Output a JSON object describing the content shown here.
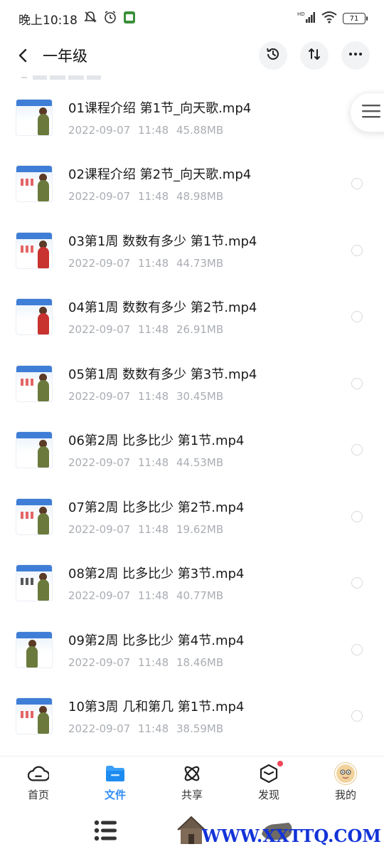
{
  "status_bar": {
    "time": "晚上10:18",
    "battery": "71"
  },
  "header": {
    "title": "一年级",
    "actions": [
      "history-icon",
      "sort-icon",
      "more-icon"
    ]
  },
  "files": [
    {
      "name": "01课程介绍 第1节_向天歌.mp4",
      "date": "2022-09-07",
      "time": "11:48",
      "size": "45.88MB"
    },
    {
      "name": "02课程介绍 第2节_向天歌.mp4",
      "date": "2022-09-07",
      "time": "11:48",
      "size": "48.98MB"
    },
    {
      "name": "03第1周 数数有多少 第1节.mp4",
      "date": "2022-09-07",
      "time": "11:48",
      "size": "44.73MB"
    },
    {
      "name": "04第1周 数数有多少 第2节.mp4",
      "date": "2022-09-07",
      "time": "11:48",
      "size": "26.91MB"
    },
    {
      "name": "05第1周 数数有多少 第3节.mp4",
      "date": "2022-09-07",
      "time": "11:48",
      "size": "30.45MB"
    },
    {
      "name": "06第2周 比多比少 第1节.mp4",
      "date": "2022-09-07",
      "time": "11:48",
      "size": "44.53MB"
    },
    {
      "name": "07第2周 比多比少 第2节.mp4",
      "date": "2022-09-07",
      "time": "11:48",
      "size": "19.62MB"
    },
    {
      "name": "08第2周 比多比少 第3节.mp4",
      "date": "2022-09-07",
      "time": "11:48",
      "size": "40.77MB"
    },
    {
      "name": "09第2周 比多比少 第4节.mp4",
      "date": "2022-09-07",
      "time": "11:48",
      "size": "18.46MB"
    },
    {
      "name": "10第3周 几和第几 第1节.mp4",
      "date": "2022-09-07",
      "time": "11:48",
      "size": "38.59MB"
    }
  ],
  "bottom_nav": [
    {
      "label": "首页",
      "icon": "cloud-home-icon",
      "active": false
    },
    {
      "label": "文件",
      "icon": "folder-icon",
      "active": true
    },
    {
      "label": "共享",
      "icon": "atom-share-icon",
      "active": false
    },
    {
      "label": "发现",
      "icon": "cube-discover-icon",
      "active": false,
      "badge": true
    },
    {
      "label": "我的",
      "icon": "avatar-icon",
      "active": false
    }
  ],
  "watermark": "WWW.XXTTQ.COM",
  "colors": {
    "accent": "#2f8cf5",
    "badge": "#f0455a",
    "meta_text": "#a9adb3",
    "watermark": "#1233d8"
  }
}
